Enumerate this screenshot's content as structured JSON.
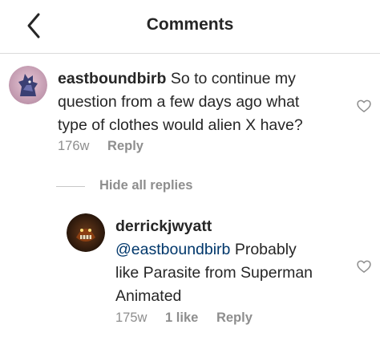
{
  "header": {
    "title": "Comments"
  },
  "comments": [
    {
      "username": "eastboundbirb",
      "text_line1": "So to continue my",
      "text_line2": "question from a few days ago what",
      "text_line3": "type of clothes would alien X have?",
      "age": "176w",
      "reply_label": "Reply"
    }
  ],
  "hide_replies_label": "Hide all replies",
  "replies": [
    {
      "username": "derrickjwyatt",
      "mention": "@eastboundbirb",
      "text_line1": "Probably",
      "text_line2": "like Parasite from Superman",
      "text_line3": "Animated",
      "age": "175w",
      "likes": "1 like",
      "reply_label": "Reply"
    }
  ],
  "icons": {
    "back": "chevron-left-icon",
    "like": "heart-outline-icon"
  },
  "colors": {
    "text": "#262626",
    "secondary": "#8e8e8e",
    "mention": "#00376b",
    "divider": "#dbdbdb"
  }
}
